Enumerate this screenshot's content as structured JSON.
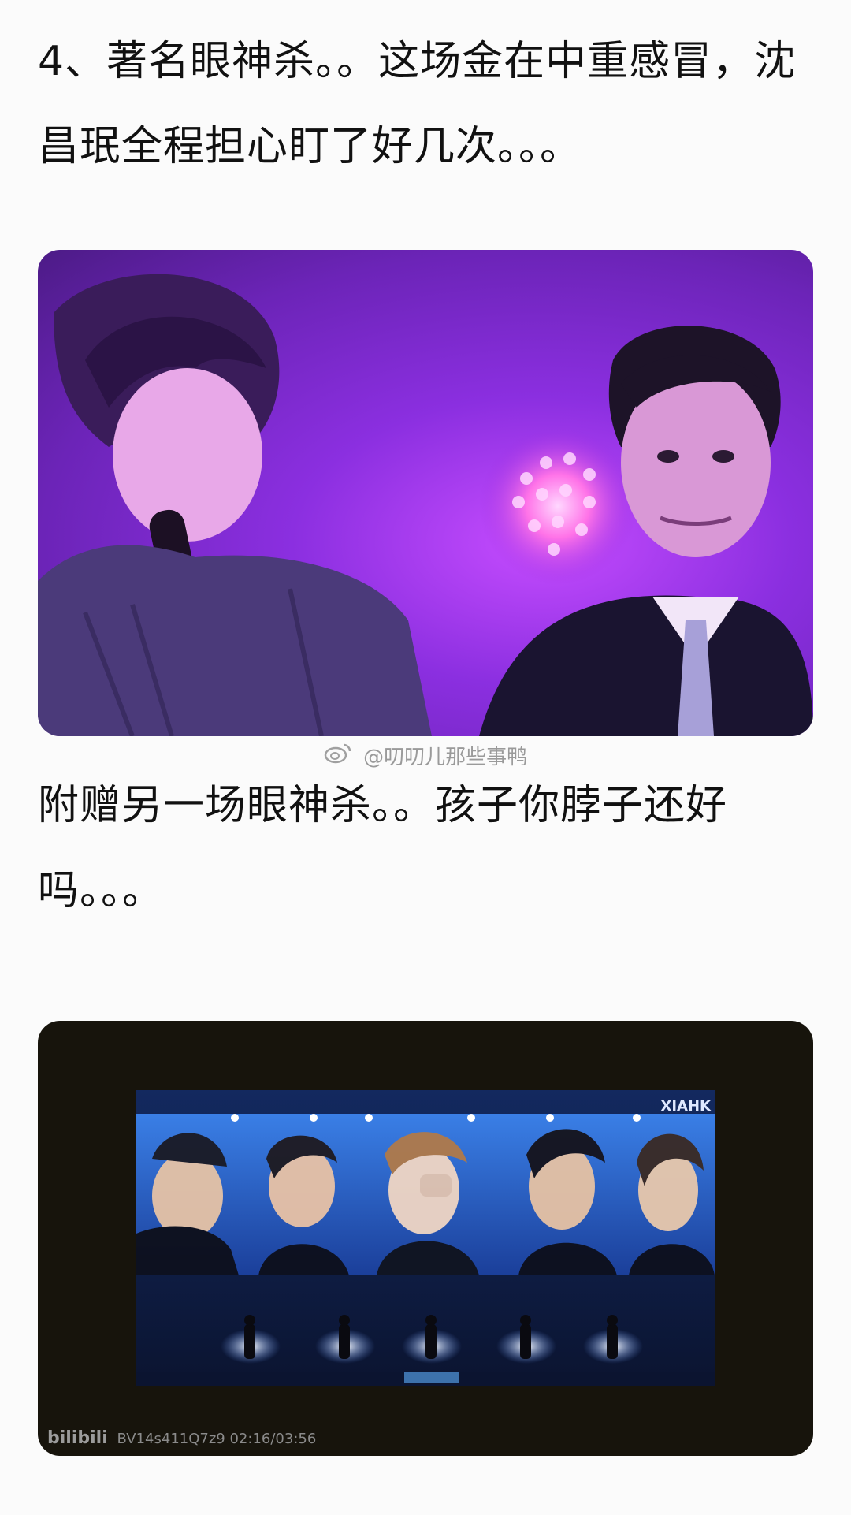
{
  "paragraphs": {
    "first": "4、著名眼神杀。。这场金在中重感冒，沈昌珉全程担心盯了好几次。。。",
    "second": "附赠另一场眼神杀。。孩子你脖子还好吗。。。"
  },
  "watermark": {
    "text": "@叨叨儿那些事鸭",
    "icon": "weibo-icon"
  },
  "video_overlay": {
    "logo": "bilibili",
    "info": "BV14s411Q7z9 02:16/03:56",
    "stage_mark": "XIAHK"
  }
}
